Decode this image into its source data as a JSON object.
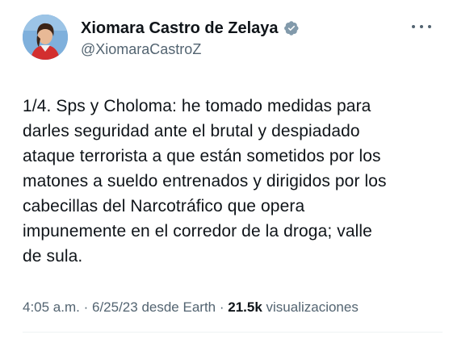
{
  "author": {
    "display_name": "Xiomara Castro de Zelaya",
    "handle": "@XiomaraCastroZ",
    "verified": true
  },
  "icons": {
    "avatar": "profile-photo",
    "verified": "verified-badge-icon",
    "more": "more-options-icon"
  },
  "tweet": {
    "text": "1/4. Sps y Choloma:  he tomado medidas para\ndarles seguridad ante el brutal y despiadado\nataque terrorista a que están sometidos por los\nmatones a sueldo  entrenados y dirigidos por los\ncabecillas del Narcotráfico que opera\nimpunemente en el corredor de la droga; valle\nde sula."
  },
  "meta": {
    "time": "4:05 a.m.",
    "separator": " · ",
    "date": "6/25/23",
    "source": " desde Earth",
    "views_count": "21.5k",
    "views_label": " visualizaciones"
  },
  "colors": {
    "text_primary": "#0f1419",
    "text_secondary": "#536471",
    "verified_badge": "#829aab",
    "divider": "#eff3f4"
  }
}
